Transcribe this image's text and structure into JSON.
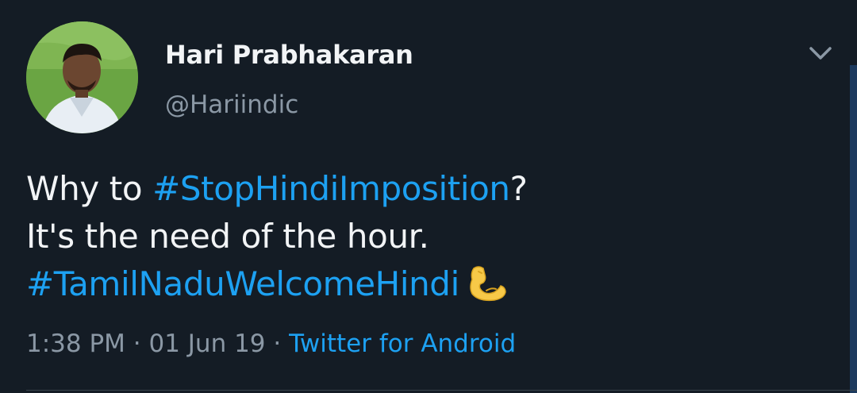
{
  "author": {
    "name": "Hari Prabhakaran",
    "handle": "@Hariindic"
  },
  "tweet": {
    "line1_prefix": "Why to ",
    "line1_hashtag": "#StopHindiImposition",
    "line1_suffix": "?",
    "line2": "It's the need of the hour.",
    "line3_hashtag": "#TamilNaduWelcomeHindi",
    "emoji": "flexed-biceps"
  },
  "meta": {
    "time": "1:38 PM",
    "sep1": " · ",
    "date": "01 Jun 19",
    "sep2": " · ",
    "source": "Twitter for Android"
  },
  "colors": {
    "background": "#141c25",
    "text": "#f2f4f6",
    "secondary": "#8b98a5",
    "link": "#1da1f2"
  },
  "icons": {
    "menu": "chevron-down-icon"
  }
}
